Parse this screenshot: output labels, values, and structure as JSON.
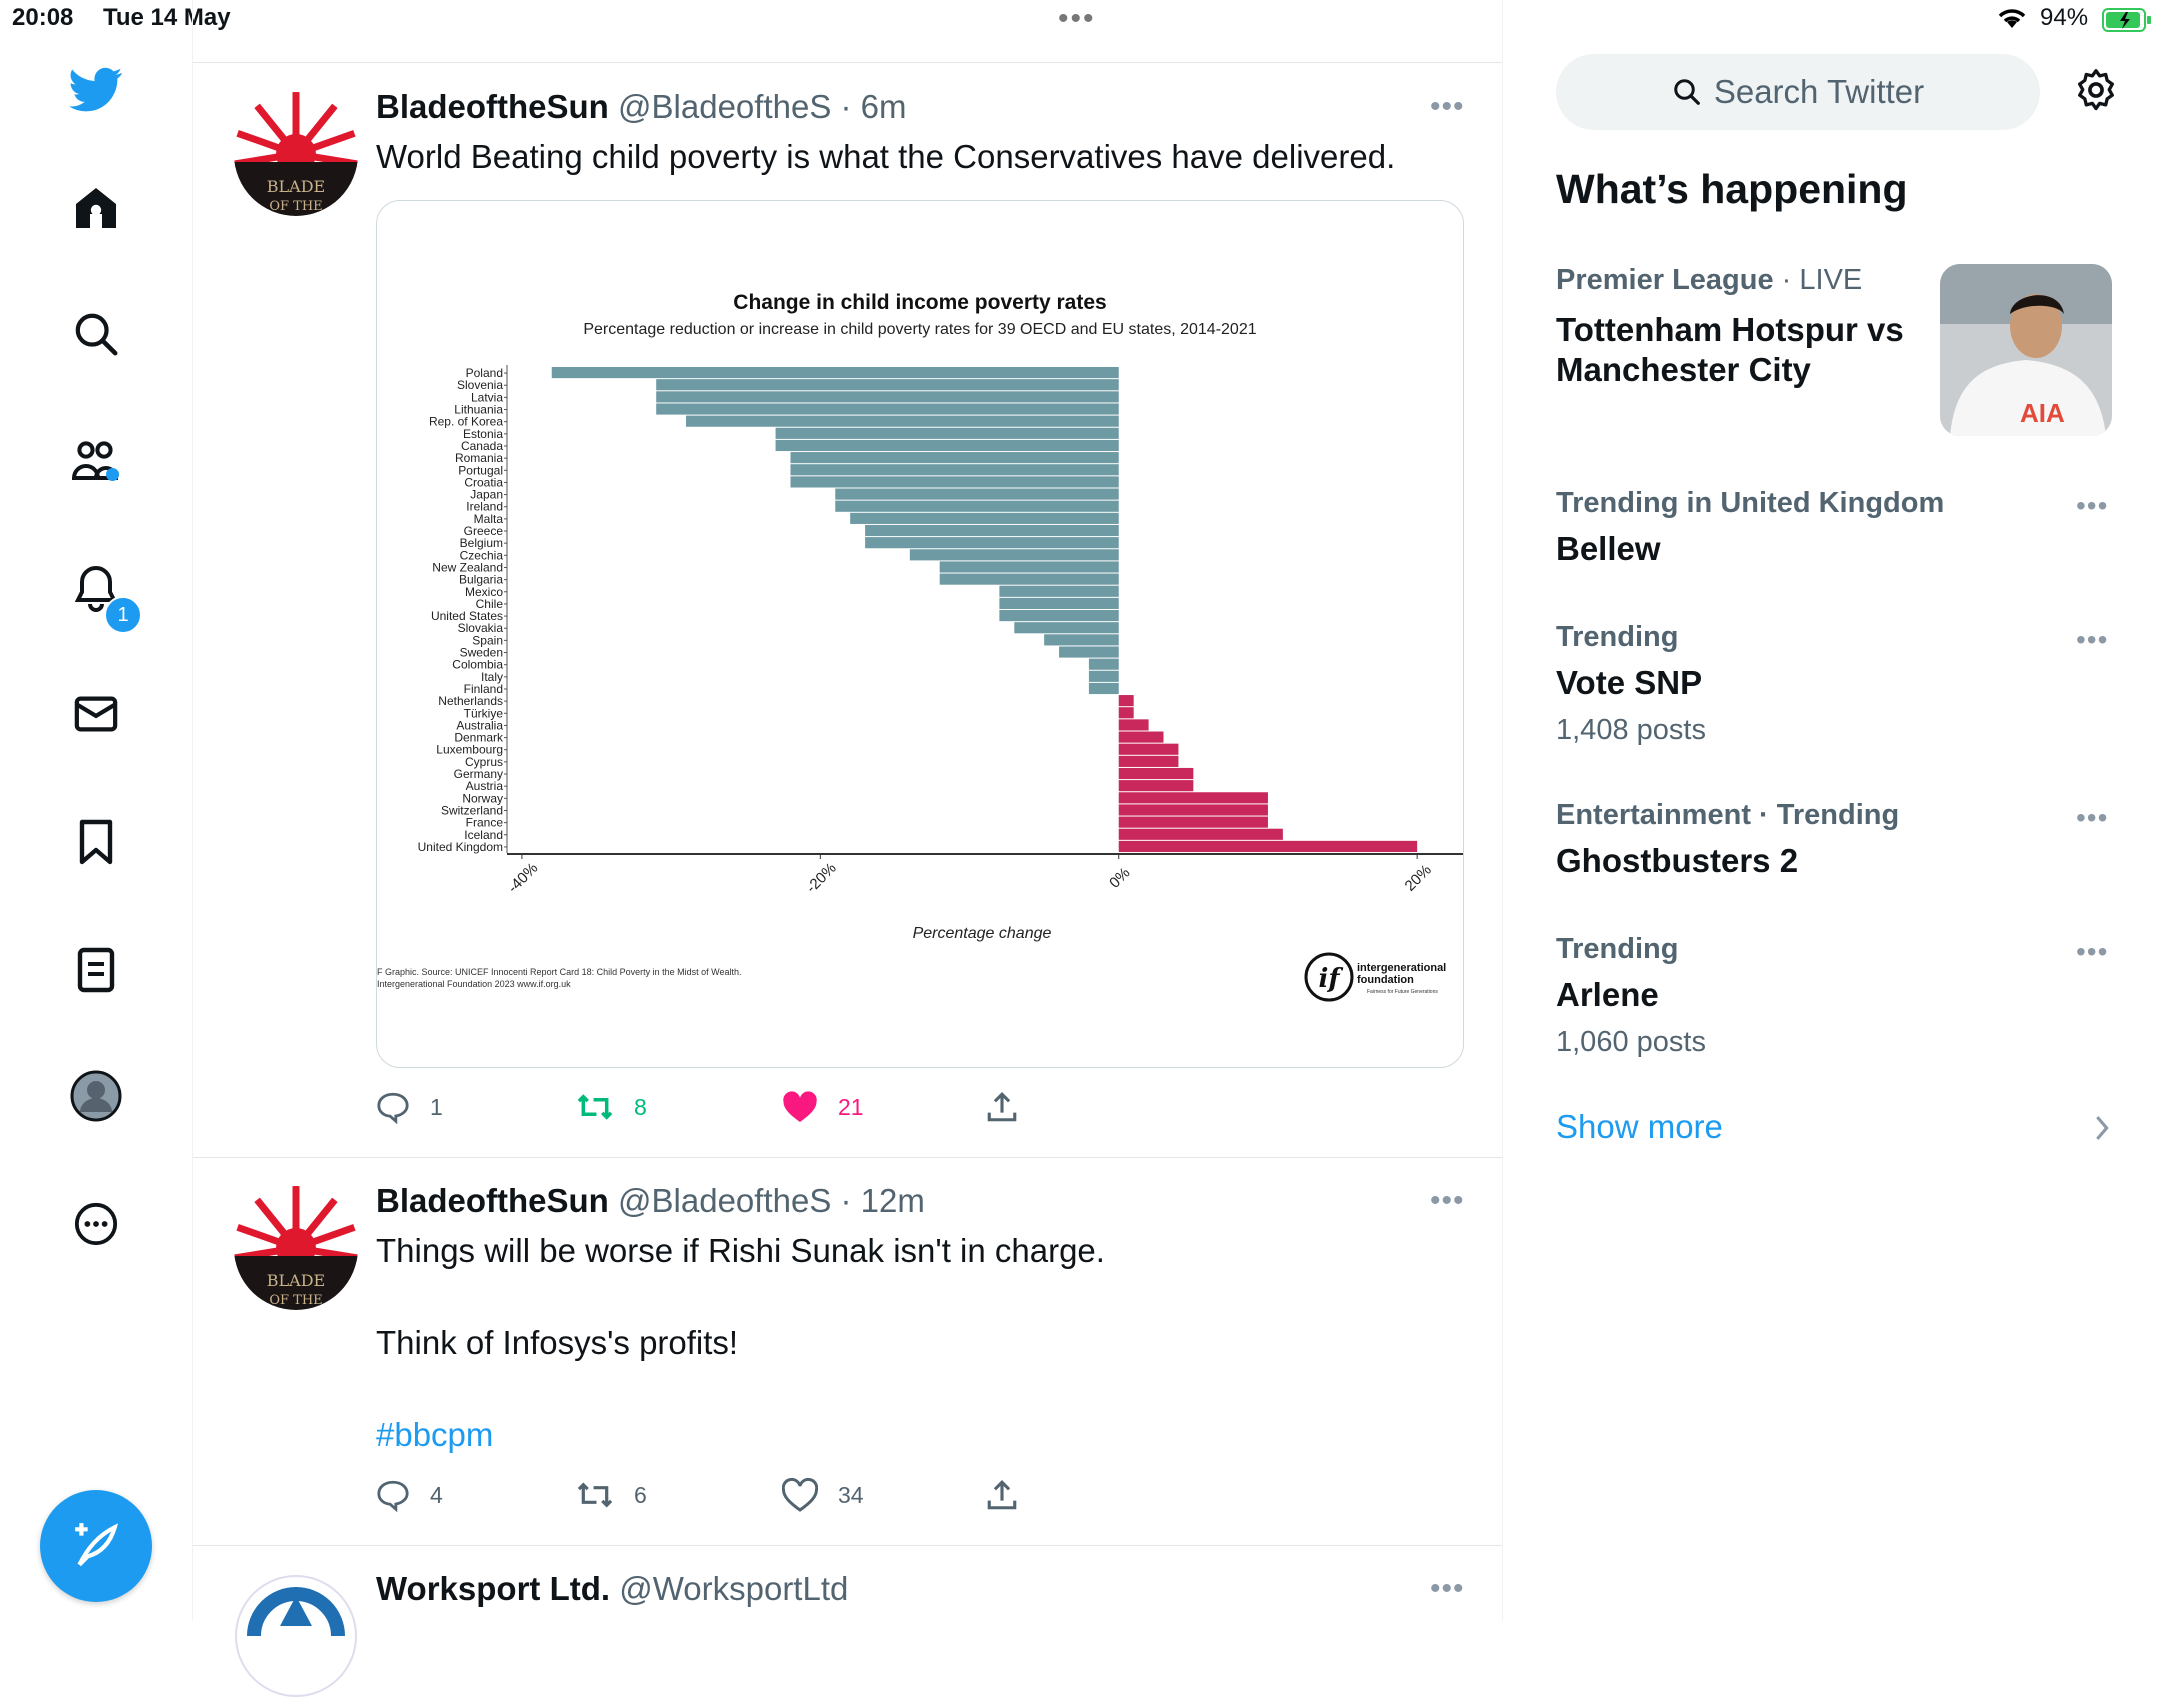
{
  "status_bar": {
    "time": "20:08",
    "date": "Tue 14 May",
    "battery": "94%"
  },
  "nav": {
    "icons": [
      "twitter-logo-icon",
      "home-icon",
      "search-icon",
      "communities-icon",
      "notifications-icon",
      "messages-icon",
      "bookmarks-icon",
      "lists-icon",
      "profile-icon",
      "more-icon"
    ],
    "notifications_count": "1"
  },
  "tweets": [
    {
      "name": "BladeoftheSun",
      "handle": "@BladeoftheS",
      "time": "· 6m",
      "text": "World Beating child poverty is what the Conservatives have delivered.",
      "replies": "1",
      "retweets": "8",
      "likes": "21"
    },
    {
      "name": "BladeoftheSun",
      "handle": "@BladeoftheS",
      "time": "· 12m",
      "text_lines": [
        "Things will be worse if Rishi Sunak isn't in charge.",
        "Think of Infosys's profits!"
      ],
      "hashtag": "#bbcpm",
      "replies": "4",
      "retweets": "6",
      "likes": "34"
    },
    {
      "name": "Worksport Ltd.",
      "handle": "@WorksportLtd"
    }
  ],
  "sidebar": {
    "search_placeholder": "Search Twitter",
    "heading": "What’s happening",
    "news": {
      "category": "Premier League",
      "live": "· LIVE",
      "title_line1": "Tottenham Hotspur vs",
      "title_line2": "Manchester City"
    },
    "trends": [
      {
        "category": "Trending in United Kingdom",
        "title": "Bellew",
        "count": ""
      },
      {
        "category": "Trending",
        "title": "Vote SNP",
        "count": "1,408 posts"
      },
      {
        "category": "Entertainment · Trending",
        "title": "Ghostbusters 2",
        "count": ""
      },
      {
        "category": "Trending",
        "title": "Arlene",
        "count": "1,060 posts"
      }
    ],
    "show_more": "Show more"
  },
  "chart_data": {
    "type": "bar",
    "orientation": "horizontal",
    "title": "Change in child income poverty rates",
    "subtitle": "Percentage reduction or increase in child poverty rates for 39 OECD and EU states, 2014-2021",
    "xlabel": "Percentage change",
    "xlim": [
      -41,
      22
    ],
    "xticks": [
      -40,
      -20,
      0,
      20
    ],
    "xtick_labels": [
      "-40%",
      "-20%",
      "0%",
      "20%"
    ],
    "categories": [
      "Poland",
      "Slovenia",
      "Latvia",
      "Lithuania",
      "Rep. of Korea",
      "Estonia",
      "Canada",
      "Romania",
      "Portugal",
      "Croatia",
      "Japan",
      "Ireland",
      "Malta",
      "Greece",
      "Belgium",
      "Czechia",
      "New Zealand",
      "Bulgaria",
      "Mexico",
      "Chile",
      "United States",
      "Slovakia",
      "Spain",
      "Sweden",
      "Colombia",
      "Italy",
      "Finland",
      "Netherlands",
      "Türkiye",
      "Australia",
      "Denmark",
      "Luxembourg",
      "Cyprus",
      "Germany",
      "Austria",
      "Norway",
      "Switzerland",
      "France",
      "Iceland",
      "United Kingdom"
    ],
    "values": [
      -38,
      -31,
      -31,
      -31,
      -29,
      -23,
      -23,
      -22,
      -22,
      -22,
      -19,
      -19,
      -18,
      -17,
      -17,
      -14,
      -12,
      -12,
      -8,
      -8,
      -8,
      -7,
      -5,
      -4,
      -2,
      -2,
      -2,
      1,
      1,
      2,
      3,
      4,
      4,
      5,
      5,
      10,
      10,
      10,
      11,
      20
    ],
    "negative_color": "#6e9aa3",
    "positive_color": "#c8285b",
    "source_line1": "F Graphic. Source: UNICEF Innocenti Report Card 18: Child Poverty in the Midst of Wealth.",
    "source_line2": "Intergenerational Foundation 2023 www.if.org.uk",
    "logo_text_line1": "intergenerational",
    "logo_text_line2": "foundation",
    "logo_tagline": "Fairness for Future Generations"
  }
}
